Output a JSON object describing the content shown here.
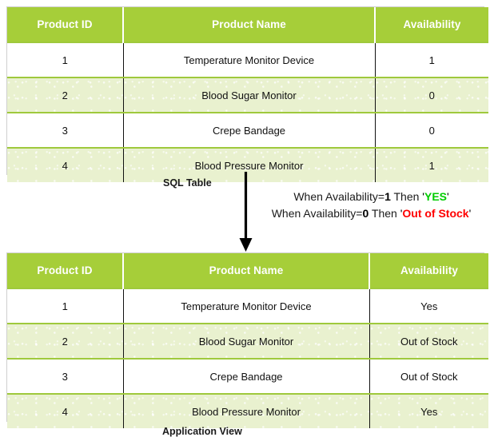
{
  "sql_table": {
    "caption": "SQL Table",
    "columns": [
      "Product ID",
      "Product Name",
      "Availability"
    ],
    "rows": [
      {
        "id": "1",
        "name": "Temperature Monitor Device",
        "availability": "1"
      },
      {
        "id": "2",
        "name": "Blood Sugar Monitor",
        "availability": "0"
      },
      {
        "id": "3",
        "name": "Crepe Bandage",
        "availability": "0"
      },
      {
        "id": "4",
        "name": "Blood Pressure Monitor",
        "availability": "1"
      }
    ]
  },
  "case_expression": {
    "line1": {
      "prefix": "When Availability=",
      "value": "1",
      "middle": " Then ",
      "open_quote": "'",
      "result": "YES",
      "close_quote": "'"
    },
    "line2": {
      "prefix": "When Availability=",
      "value": "0",
      "middle": " Then ",
      "open_quote": "'",
      "result": "Out of Stock",
      "close_quote": "'"
    }
  },
  "app_table": {
    "caption": "Application View",
    "columns": [
      "Product ID",
      "Product Name",
      "Availability"
    ],
    "rows": [
      {
        "id": "1",
        "name": "Temperature Monitor Device",
        "availability": "Yes"
      },
      {
        "id": "2",
        "name": "Blood Sugar Monitor",
        "availability": "Out of Stock"
      },
      {
        "id": "3",
        "name": "Crepe Bandage",
        "availability": "Out of Stock"
      },
      {
        "id": "4",
        "name": "Blood Pressure Monitor",
        "availability": "Yes"
      }
    ]
  },
  "arrow": {
    "icon": "down-arrow-icon"
  },
  "colors": {
    "header_green": "#a6ce39",
    "row_alt_green": "#e9f1cf",
    "row_white": "#ffffff",
    "grid_green": "#9fc93c",
    "yes_green": "#00cc00",
    "out_of_stock_red": "#ff0000",
    "text_black": "#111111"
  }
}
